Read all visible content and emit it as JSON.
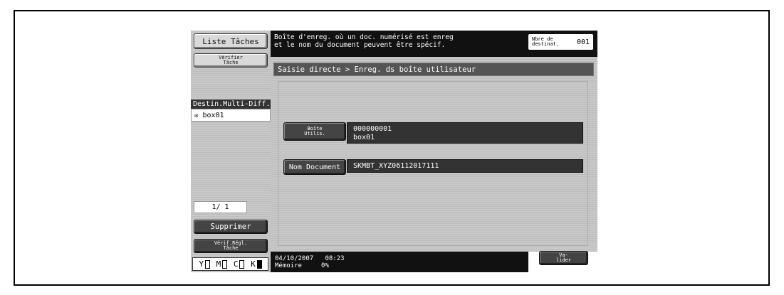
{
  "sidebar": {
    "job_list_label": "Liste Tâches",
    "check_job_label": "Vérifier Tâche",
    "dest_title": "Destin.Multi-Diff.",
    "dest_items": [
      {
        "icon": "box-icon",
        "label": "box01"
      }
    ],
    "page_indicator": "1/ 1",
    "delete_label": "Supprimer",
    "check_settings_label": "Vérif.Régl. Tâche",
    "ink": [
      {
        "letter": "Y",
        "level": "low"
      },
      {
        "letter": "M",
        "level": "low"
      },
      {
        "letter": "C",
        "level": "low"
      },
      {
        "letter": "K",
        "level": "full"
      }
    ]
  },
  "header": {
    "message_line1": "Boîte d'enreg. où un doc. numérisé est enreg",
    "message_line2": "et le nom du document peuvent être spécif.",
    "dest_count_label": "Nbre de destinat.",
    "dest_count_value": "001"
  },
  "breadcrumb": "Saisie directe > Enreg. ds boîte utilisateur",
  "fields": {
    "user_box_label": "Boîte Utilis.",
    "user_box_number": "000000001",
    "user_box_name": "box01",
    "doc_name_label": "Nom Document",
    "doc_name_value": "SKMBT_XYZ06112017111"
  },
  "footer": {
    "date": "04/10/2007",
    "time": "08:23",
    "memory_label": "Mémoire",
    "memory_value": "0%",
    "validate_label": "Va- lider"
  }
}
